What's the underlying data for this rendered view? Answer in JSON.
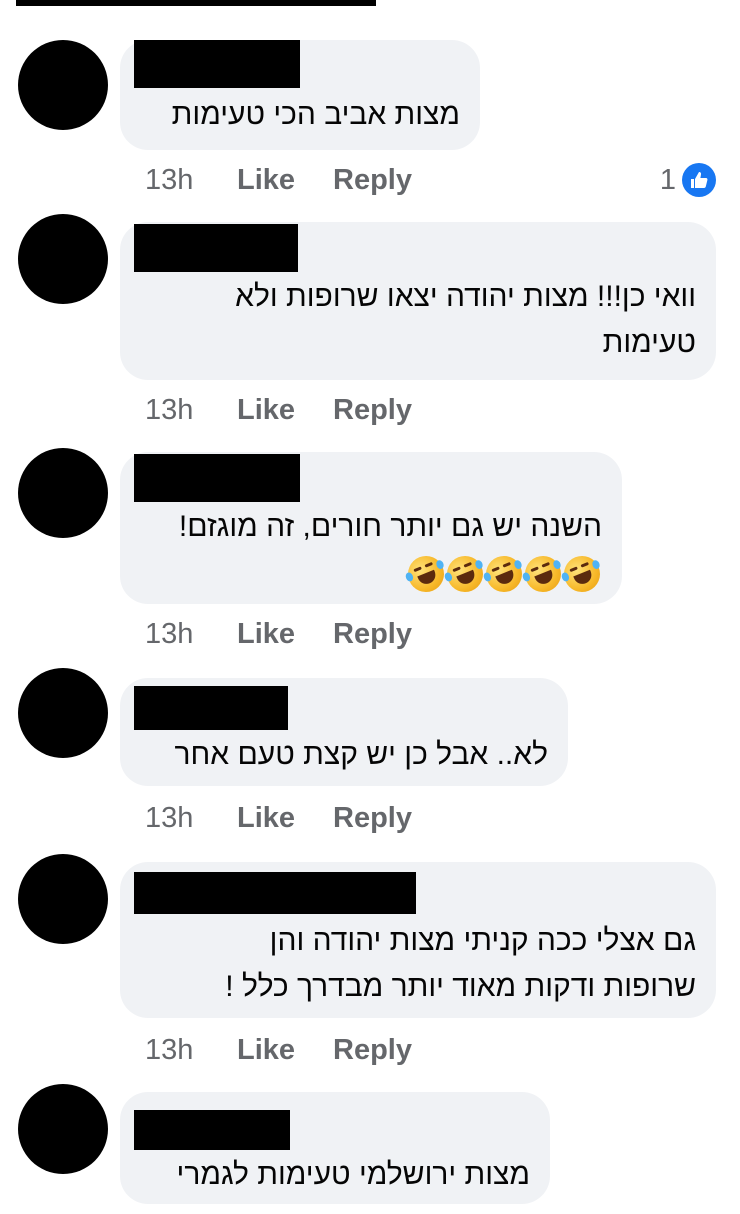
{
  "comments": [
    {
      "text": "מצות אביב הכי טעימות",
      "time": "13h",
      "like": "Like",
      "reply": "Reply",
      "reaction_count": "1"
    },
    {
      "text": "וואי כן!!! מצות יהודה יצאו שרופות ולא\nטעימות",
      "time": "13h",
      "like": "Like",
      "reply": "Reply"
    },
    {
      "text": "השנה יש גם יותר חורים, זה מוגזם!",
      "emoji": "face-with-tears-of-joy x5",
      "time": "13h",
      "like": "Like",
      "reply": "Reply"
    },
    {
      "text": "לא.. אבל כן יש קצת טעם אחר",
      "time": "13h",
      "like": "Like",
      "reply": "Reply"
    },
    {
      "text": "גם אצלי ככה קניתי מצות יהודה והן\nשרופות ודקות מאוד יותר מבדרך כלל !",
      "time": "13h",
      "like": "Like",
      "reply": "Reply"
    },
    {
      "text": "מצות ירושלמי טעימות לגמרי"
    }
  ],
  "colors": {
    "bubble": "#f0f2f5",
    "meta_text": "#65676b",
    "like_blue": "#1877f2"
  }
}
